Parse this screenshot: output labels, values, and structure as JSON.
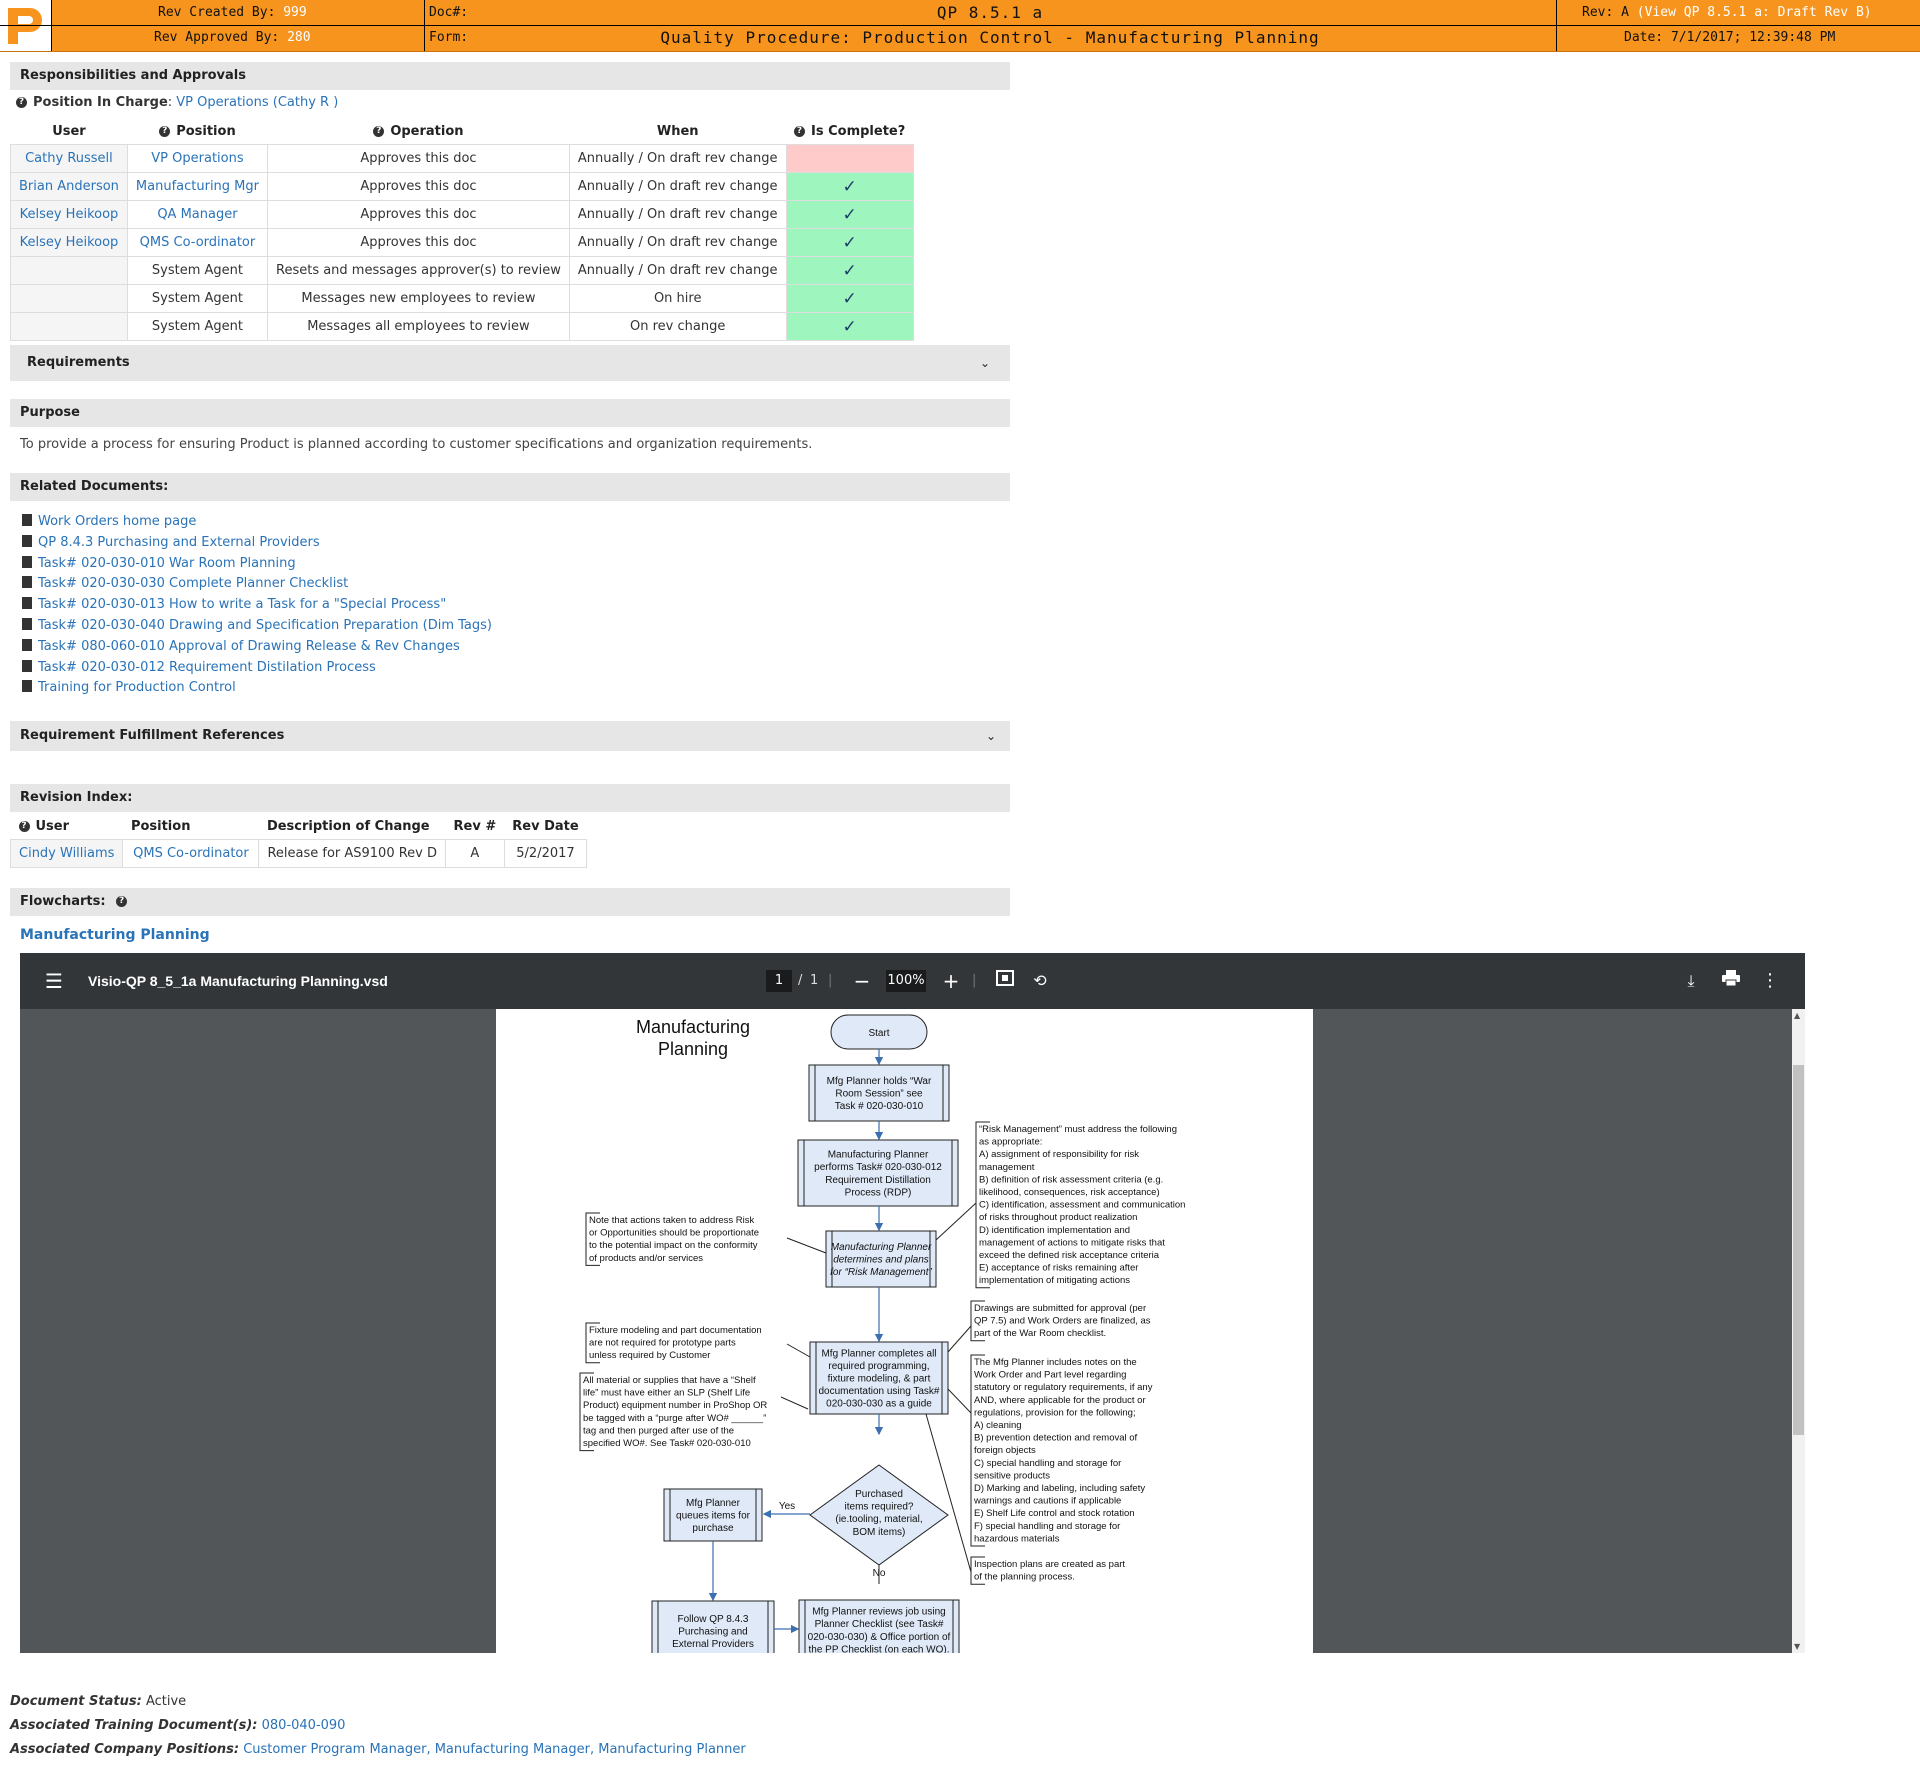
{
  "header": {
    "rev_created_label": "Rev Created By:",
    "rev_created_value": "999",
    "rev_approved_label": "Rev Approved By:",
    "rev_approved_value": "280",
    "doc_label": "Doc#:",
    "doc_number": "QP 8.5.1 a",
    "form_label": "Form:",
    "form_title": "Quality Procedure: Production Control - Manufacturing Planning",
    "rev_label": "Rev: A",
    "rev_link": "(View QP 8.5.1 a: Draft Rev B)",
    "date": "Date: 7/1/2017; 12:39:48 PM"
  },
  "responsibilities": {
    "title": "Responsibilities and Approvals",
    "position_in_charge_label": "Position In Charge",
    "position_in_charge_value": "VP Operations (Cathy R )",
    "columns": [
      "User",
      "Position",
      "Operation",
      "When",
      "Is Complete?"
    ],
    "rows": [
      {
        "user": "Cathy Russell",
        "position": "VP Operations",
        "operation": "Approves this doc",
        "when": "Annually / On draft rev change",
        "complete": false
      },
      {
        "user": "Brian Anderson",
        "position": "Manufacturing Mgr",
        "operation": "Approves this doc",
        "when": "Annually / On draft rev change",
        "complete": true
      },
      {
        "user": "Kelsey Heikoop",
        "position": "QA Manager",
        "operation": "Approves this doc",
        "when": "Annually / On draft rev change",
        "complete": true
      },
      {
        "user": "Kelsey Heikoop",
        "position": "QMS Co-ordinator",
        "operation": "Approves this doc",
        "when": "Annually / On draft rev change",
        "complete": true
      },
      {
        "user": "",
        "position": "System Agent",
        "operation": "Resets and messages approver(s) to review",
        "when": "Annually / On draft rev change",
        "complete": true
      },
      {
        "user": "",
        "position": "System Agent",
        "operation": "Messages new employees to review",
        "when": "On hire",
        "complete": true
      },
      {
        "user": "",
        "position": "System Agent",
        "operation": "Messages all employees to review",
        "when": "On rev change",
        "complete": true
      }
    ]
  },
  "requirements": {
    "title": "Requirements"
  },
  "purpose": {
    "title": "Purpose",
    "text": "To provide a process for ensuring Product is planned according to customer specifications and organization requirements."
  },
  "related": {
    "title": "Related Documents:",
    "items": [
      "Work Orders home page",
      "QP 8.4.3 Purchasing and External Providers",
      "Task# 020-030-010 War Room Planning",
      "Task# 020-030-030 Complete Planner Checklist",
      "Task# 020-030-013 How to write a Task for a \"Special Process\"",
      "Task# 020-030-040 Drawing and Specification Preparation (Dim Tags)",
      "Task# 080-060-010 Approval of Drawing Release & Rev Changes",
      "Task# 020-030-012 Requirement Distilation Process",
      "Training for Production Control"
    ]
  },
  "fulfillment": {
    "title": "Requirement Fulfillment References"
  },
  "revision": {
    "title": "Revision Index:",
    "columns": [
      "User",
      "Position",
      "Description of Change",
      "Rev #",
      "Rev Date"
    ],
    "rows": [
      {
        "user": "Cindy Williams",
        "position": "QMS Co-ordinator",
        "description": "Release for AS9100 Rev D",
        "rev": "A",
        "date": "5/2/2017"
      }
    ]
  },
  "flowcharts": {
    "title": "Flowcharts:",
    "link": "Manufacturing Planning"
  },
  "viewer": {
    "filename": "Visio-QP 8_5_1a Manufacturing Planning.vsd",
    "page_current": "1",
    "page_sep": "/",
    "page_total": "1",
    "zoom": "100%"
  },
  "flow": {
    "title_line1": "Manufacturing",
    "title_line2": "Planning",
    "start": "Start",
    "box1": [
      "Mfg Planner holds “War",
      "Room Session” see",
      "Task # 020-030-010"
    ],
    "box2": [
      "Manufacturing Planner",
      "performs Task# 020-030-012",
      "Requirement Distillation",
      "Process (RDP)"
    ],
    "box3": [
      "Manufacturing Planner",
      "determines and plans",
      "for “Risk Management”"
    ],
    "box4": [
      "Mfg Planner completes all",
      "required programming,",
      "fixture modeling, & part",
      "documentation using Task#",
      "020-030-030 as a guide"
    ],
    "decision": [
      "Purchased",
      "items required?",
      "(ie.tooling, material,",
      "BOM items)"
    ],
    "yes": "Yes",
    "no": "No",
    "queue": [
      "Mfg Planner",
      "queues items for",
      "purchase"
    ],
    "follow": [
      "Follow QP 8.4.3",
      "Purchasing and",
      "External Providers"
    ],
    "review": [
      "Mfg Planner reviews job using",
      "Planner Checklist (see Task#",
      "020-030-030) & Office portion of",
      "the PP Checklist (on each WO)."
    ],
    "note_risk_left": [
      "Note that actions taken to address Risk",
      "or Opportunities should be proportionate",
      "to the potential impact on the conformity",
      "of products and/or services"
    ],
    "note_risk_right": [
      "“Risk Management” must address the following",
      "as appropriate:",
      "A) assignment of responsibility for risk",
      "management",
      "B) definition of risk assessment criteria (e.g.",
      "likelihood, consequences, risk acceptance)",
      "C) identification, assessment and communication",
      "of risks throughout product realization",
      "D) identification implementation and",
      "management of actions to mitigate risks that",
      "exceed the defined risk acceptance criteria",
      "E) acceptance of risks remaining after",
      "implementation of mitigating actions"
    ],
    "note_fixture": [
      "Fixture modeling and part documentation",
      "are not required for prototype parts",
      "unless required by Customer"
    ],
    "note_shelf": [
      "All material or supplies that have a “Shelf",
      "life” must have either an SLP (Shelf Life",
      "Product) equipment number in ProShop OR",
      "be tagged with a “purge after WO# ______”",
      "tag and then purged after use of the",
      "specified WO#. See Task# 020-030-010"
    ],
    "note_drawings": [
      "Drawings are submitted for approval (per",
      "QP 7.5) and Work Orders are finalized, as",
      "part of the War Room checklist."
    ],
    "note_notes": [
      "The Mfg Planner includes notes on the",
      "Work Order and Part level regarding",
      "statutory or regulatory requirements, if any",
      "AND, where applicable for the product or",
      "regulations, provision for the following;",
      "A) cleaning",
      "B) prevention detection and removal of",
      "foreign objects",
      "C) special handling and storage for",
      "sensitive products",
      "D) Marking and labeling, including safety",
      "warnings and cautions if applicable",
      "E) Shelf Life control and stock rotation",
      "F) special handling and storage for",
      "hazardous materials"
    ],
    "note_inspection": [
      "Inspection plans are created as part",
      "of the planning process."
    ]
  },
  "footer": {
    "status_label": "Document Status:",
    "status_value": "Active",
    "training_label": "Associated Training Document(s):",
    "training_value": "080-040-090",
    "positions_label": "Associated Company Positions:",
    "positions_value": "Customer Program Manager, Manufacturing Manager, Manufacturing Planner"
  },
  "colors": {
    "header": "#f7941e",
    "ok": "#9ef5bd",
    "not_ok": "#fecaca",
    "link": "#2a73b8",
    "viewer_toolbar": "#323639"
  }
}
